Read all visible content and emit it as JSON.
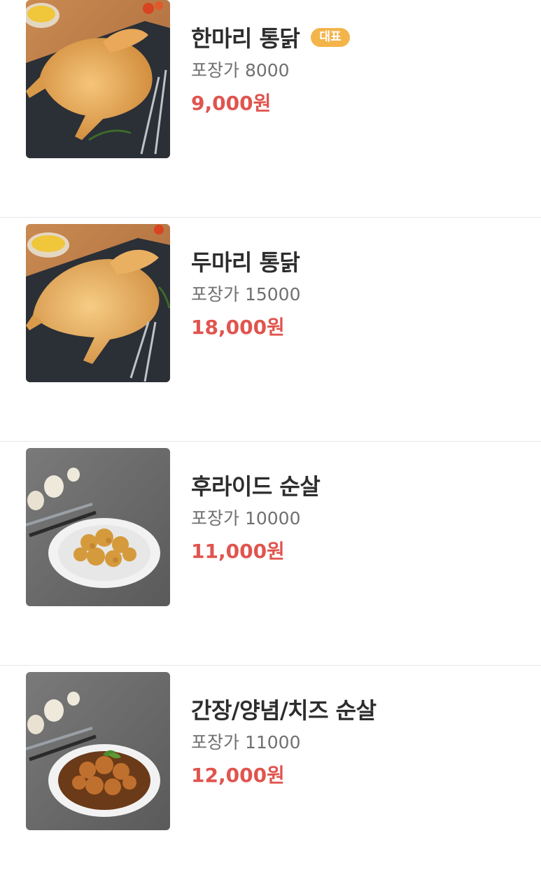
{
  "menu": {
    "items": [
      {
        "name": "한마리 통닭",
        "badge": "대표",
        "takeout": "포장가 8000",
        "price": "9,000원",
        "image": "whole-chicken-photo"
      },
      {
        "name": "두마리 통닭",
        "takeout": "포장가 15000",
        "price": "18,000원",
        "image": "whole-chicken-photo"
      },
      {
        "name": "후라이드 순살",
        "takeout": "포장가 10000",
        "price": "11,000원",
        "image": "boneless-fried-chicken-photo"
      },
      {
        "name": "간장/양념/치즈 순살",
        "takeout": "포장가 11000",
        "price": "12,000원",
        "image": "boneless-sauced-chicken-photo"
      }
    ]
  },
  "colors": {
    "price": "#e1544e",
    "badge": "#f3b44a",
    "name": "#2d2d2d",
    "sub": "#707070",
    "divider": "#e9e9ec"
  }
}
